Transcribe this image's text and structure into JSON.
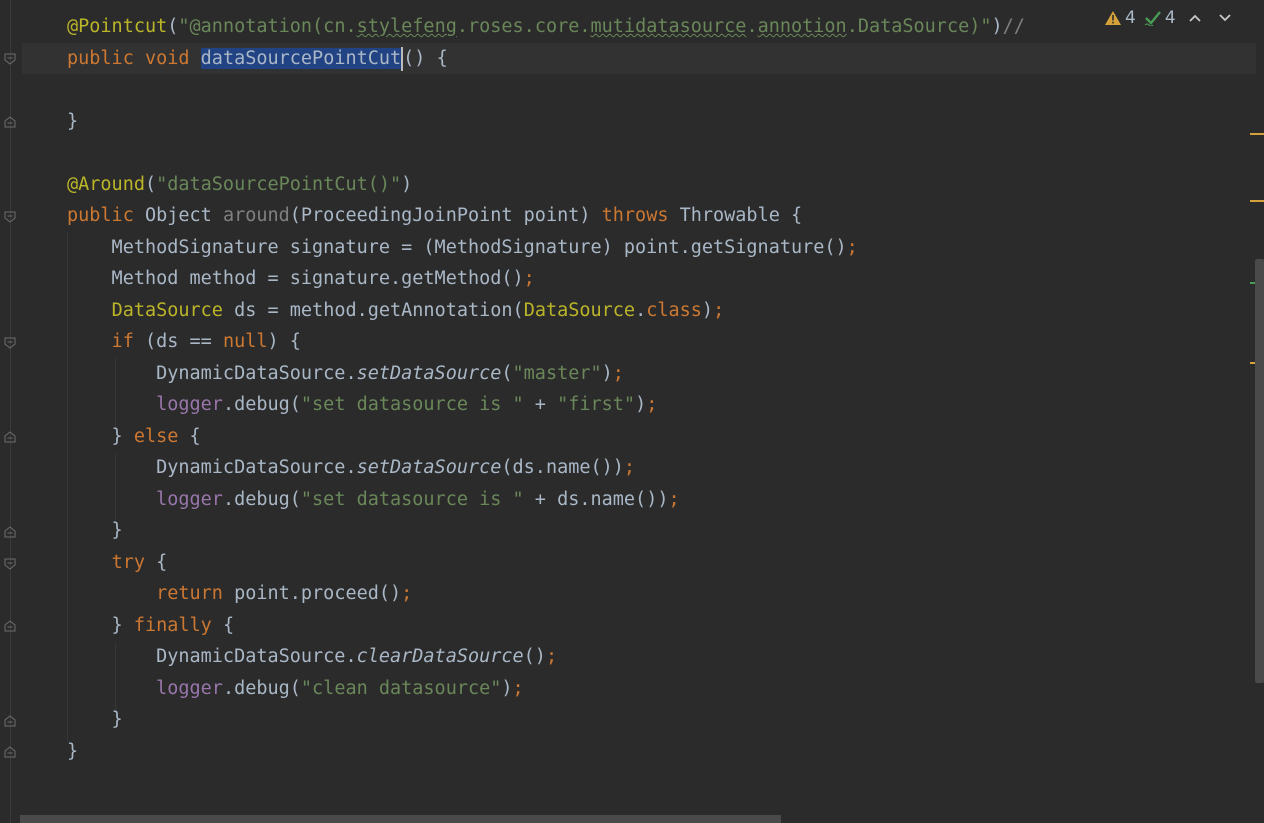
{
  "inspection": {
    "warnings_count": "4",
    "checks_count": "4"
  },
  "code_lines": [
    {
      "segments": [
        {
          "t": "@Pointcut",
          "c": "ann"
        },
        {
          "t": "(",
          "c": ""
        },
        {
          "t": "\"@annotation(cn.",
          "c": "str"
        },
        {
          "t": "stylefeng",
          "c": "str warnunder"
        },
        {
          "t": ".roses.core.",
          "c": "str"
        },
        {
          "t": "mutidatasource",
          "c": "str warnunder"
        },
        {
          "t": ".",
          "c": "str"
        },
        {
          "t": "annotion",
          "c": "str warnunder"
        },
        {
          "t": ".DataSource)\"",
          "c": "str"
        },
        {
          "t": ")",
          "c": ""
        },
        {
          "t": "//",
          "c": "comment"
        }
      ]
    },
    {
      "segments": [
        {
          "t": "public ",
          "c": "kw"
        },
        {
          "t": "void ",
          "c": "kw"
        },
        {
          "t": "dataSourcePointCut",
          "c": "sel"
        },
        {
          "t": "",
          "c": "caret"
        },
        {
          "t": "() {",
          "c": ""
        }
      ]
    },
    {
      "segments": []
    },
    {
      "segments": [
        {
          "t": "}",
          "c": ""
        }
      ]
    },
    {
      "segments": []
    },
    {
      "segments": [
        {
          "t": "@Around",
          "c": "ann"
        },
        {
          "t": "(",
          "c": ""
        },
        {
          "t": "\"dataSourcePointCut()\"",
          "c": "str"
        },
        {
          "t": ")",
          "c": ""
        }
      ]
    },
    {
      "segments": [
        {
          "t": "public ",
          "c": "kw"
        },
        {
          "t": "Object ",
          "c": ""
        },
        {
          "t": "around",
          "c": "unused"
        },
        {
          "t": "(ProceedingJoinPoint point) ",
          "c": ""
        },
        {
          "t": "throws ",
          "c": "kw"
        },
        {
          "t": "Throwable {",
          "c": ""
        }
      ]
    },
    {
      "segments": [
        {
          "t": "    MethodSignature signature = (MethodSignature) point.getSignature()",
          "c": ""
        },
        {
          "t": ";",
          "c": "kw"
        }
      ]
    },
    {
      "segments": [
        {
          "t": "    Method method = signature.getMethod()",
          "c": ""
        },
        {
          "t": ";",
          "c": "kw"
        }
      ]
    },
    {
      "segments": [
        {
          "t": "    ",
          "c": ""
        },
        {
          "t": "DataSource",
          "c": "cls"
        },
        {
          "t": " ds = method.getAnnotation(",
          "c": ""
        },
        {
          "t": "DataSource",
          "c": "cls"
        },
        {
          "t": ".",
          "c": ""
        },
        {
          "t": "class",
          "c": "kw"
        },
        {
          "t": ")",
          "c": ""
        },
        {
          "t": ";",
          "c": "kw"
        }
      ]
    },
    {
      "segments": [
        {
          "t": "    ",
          "c": ""
        },
        {
          "t": "if ",
          "c": "kw"
        },
        {
          "t": "(ds == ",
          "c": ""
        },
        {
          "t": "null",
          "c": "kw"
        },
        {
          "t": ") {",
          "c": ""
        }
      ]
    },
    {
      "segments": [
        {
          "t": "        DynamicDataSource.",
          "c": ""
        },
        {
          "t": "setDataSource",
          "c": "itl"
        },
        {
          "t": "(",
          "c": ""
        },
        {
          "t": "\"master\"",
          "c": "str"
        },
        {
          "t": ")",
          "c": ""
        },
        {
          "t": ";",
          "c": "kw"
        }
      ]
    },
    {
      "segments": [
        {
          "t": "        ",
          "c": ""
        },
        {
          "t": "logger",
          "c": "fld"
        },
        {
          "t": ".debug(",
          "c": ""
        },
        {
          "t": "\"set datasource is \"",
          "c": "str"
        },
        {
          "t": " + ",
          "c": ""
        },
        {
          "t": "\"first\"",
          "c": "str"
        },
        {
          "t": ")",
          "c": ""
        },
        {
          "t": ";",
          "c": "kw"
        }
      ]
    },
    {
      "segments": [
        {
          "t": "    } ",
          "c": ""
        },
        {
          "t": "else ",
          "c": "kw"
        },
        {
          "t": "{",
          "c": ""
        }
      ]
    },
    {
      "segments": [
        {
          "t": "        DynamicDataSource.",
          "c": ""
        },
        {
          "t": "setDataSource",
          "c": "itl"
        },
        {
          "t": "(ds.name())",
          "c": ""
        },
        {
          "t": ";",
          "c": "kw"
        }
      ]
    },
    {
      "segments": [
        {
          "t": "        ",
          "c": ""
        },
        {
          "t": "logger",
          "c": "fld"
        },
        {
          "t": ".debug(",
          "c": ""
        },
        {
          "t": "\"set datasource is \"",
          "c": "str"
        },
        {
          "t": " + ds.name())",
          "c": ""
        },
        {
          "t": ";",
          "c": "kw"
        }
      ]
    },
    {
      "segments": [
        {
          "t": "    }",
          "c": ""
        }
      ]
    },
    {
      "segments": [
        {
          "t": "    ",
          "c": ""
        },
        {
          "t": "try ",
          "c": "kw"
        },
        {
          "t": "{",
          "c": ""
        }
      ]
    },
    {
      "segments": [
        {
          "t": "        ",
          "c": ""
        },
        {
          "t": "return ",
          "c": "kw"
        },
        {
          "t": "point.proceed()",
          "c": ""
        },
        {
          "t": ";",
          "c": "kw"
        }
      ]
    },
    {
      "segments": [
        {
          "t": "    } ",
          "c": ""
        },
        {
          "t": "finally ",
          "c": "kw"
        },
        {
          "t": "{",
          "c": ""
        }
      ]
    },
    {
      "segments": [
        {
          "t": "        DynamicDataSource.",
          "c": ""
        },
        {
          "t": "clearDataSource",
          "c": "itl"
        },
        {
          "t": "()",
          "c": ""
        },
        {
          "t": ";",
          "c": "kw"
        }
      ]
    },
    {
      "segments": [
        {
          "t": "        ",
          "c": ""
        },
        {
          "t": "logger",
          "c": "fld"
        },
        {
          "t": ".debug(",
          "c": ""
        },
        {
          "t": "\"clean datasource\"",
          "c": "str"
        },
        {
          "t": ")",
          "c": ""
        },
        {
          "t": ";",
          "c": "kw"
        }
      ]
    },
    {
      "segments": [
        {
          "t": "    }",
          "c": ""
        }
      ]
    },
    {
      "segments": [
        {
          "t": "}",
          "c": ""
        }
      ]
    }
  ],
  "colors": {
    "background": "#2b2b2b",
    "keyword": "#cc7832",
    "annotation": "#bbb529",
    "string": "#6a8759",
    "field": "#9876aa",
    "selection": "#214283",
    "warning_marker": "#d5a13a",
    "ok_marker": "#499c54"
  }
}
